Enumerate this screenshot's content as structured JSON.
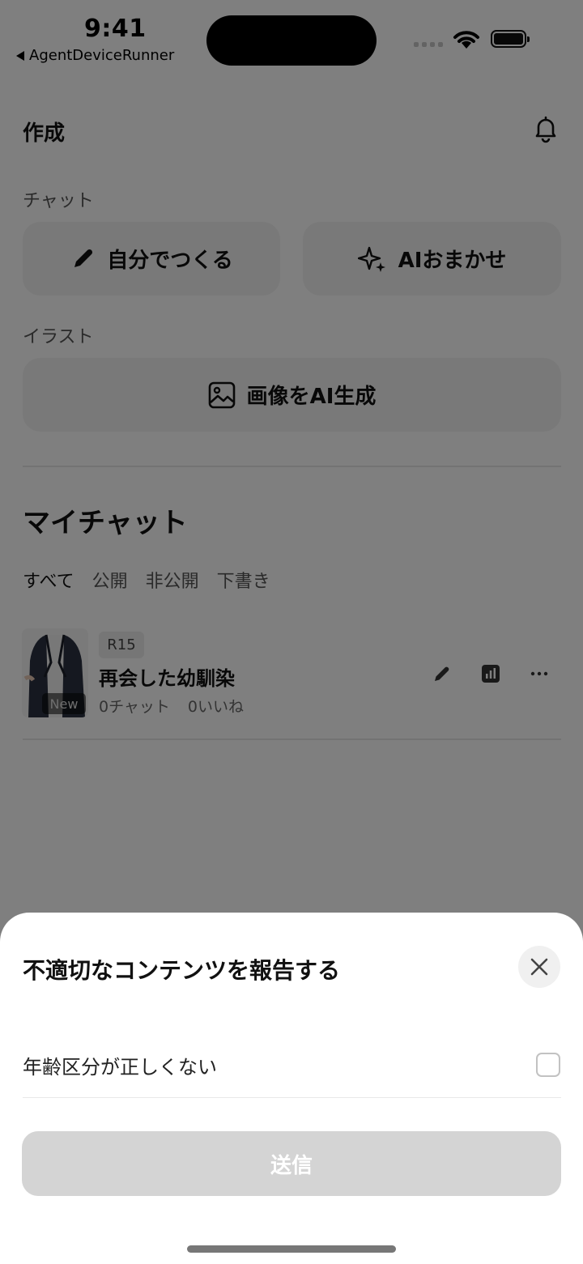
{
  "status_bar": {
    "time": "9:41",
    "back_app": "AgentDeviceRunner"
  },
  "header": {
    "title": "作成"
  },
  "create": {
    "chat_label": "チャット",
    "self_create": "自分でつくる",
    "ai_create": "AIおまかせ",
    "illust_label": "イラスト",
    "image_ai": "画像をAI生成"
  },
  "my_chats": {
    "title": "マイチャット",
    "filters": [
      "すべて",
      "公開",
      "非公開",
      "下書き"
    ],
    "items": [
      {
        "rating": "R15",
        "title": "再会した幼馴染",
        "chats": "0チャット",
        "likes": "0いいね",
        "badge": "New"
      }
    ]
  },
  "sheet": {
    "title": "不適切なコンテンツを報告する",
    "options": [
      {
        "label": "年齢区分が正しくない",
        "checked": false
      }
    ],
    "submit": "送信"
  },
  "colors": {
    "overlay": "#808080",
    "submit_disabled": "#d4d4d4"
  }
}
